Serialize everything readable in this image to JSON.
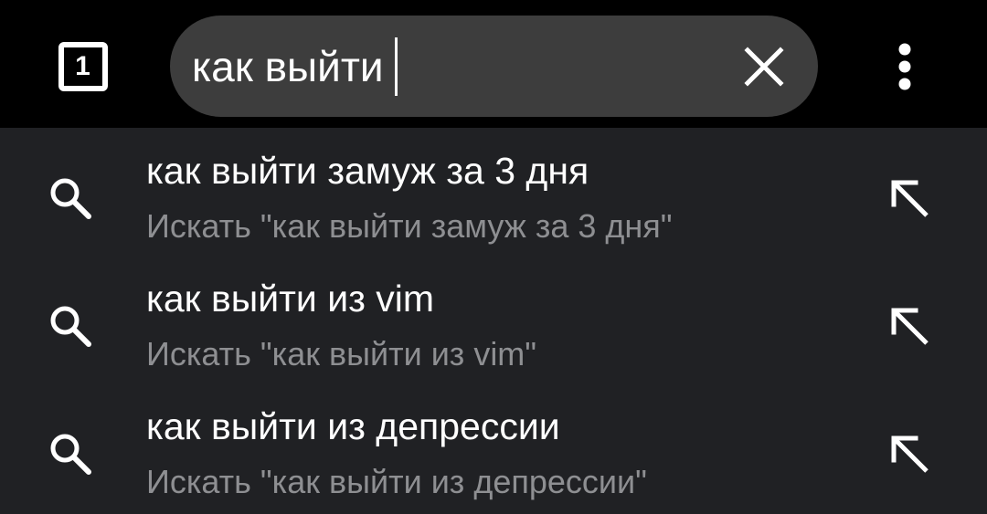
{
  "topbar": {
    "tab_count": "1",
    "search_query": "как выйти"
  },
  "icons": {
    "tabs": "tab-switcher-icon",
    "clear": "close-icon",
    "menu": "more-vert-icon",
    "search": "search-icon",
    "fill": "arrow-up-left-icon"
  },
  "colors": {
    "background": "#000000",
    "search_box": "#3d3d3d",
    "suggestion_panel": "#202124",
    "primary_text": "#ffffff",
    "secondary_text": "#8e8f92"
  },
  "suggestions": [
    {
      "title": "как выйти замуж за 3 дня",
      "subtitle": "Искать \"как выйти замуж за 3 дня\""
    },
    {
      "title": "как выйти из vim",
      "subtitle": "Искать \"как выйти из vim\""
    },
    {
      "title": "как выйти из депрессии",
      "subtitle": "Искать \"как выйти из депрессии\""
    }
  ]
}
